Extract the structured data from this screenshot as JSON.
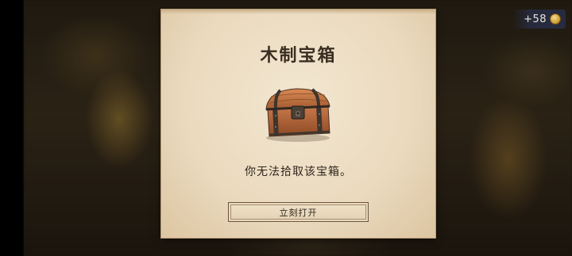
{
  "hud": {
    "currency_amount": "+58",
    "currency_icon": "coin-icon"
  },
  "dialog": {
    "title": "木制宝箱",
    "item_icon": "treasure-chest-icon",
    "message": "你无法拾取该宝箱。",
    "open_button_label": "立刻打开"
  },
  "colors": {
    "panel": "#ead9bd",
    "text": "#2f261d",
    "chest_wood": "#b86a3c",
    "chest_iron": "#4a4037"
  }
}
